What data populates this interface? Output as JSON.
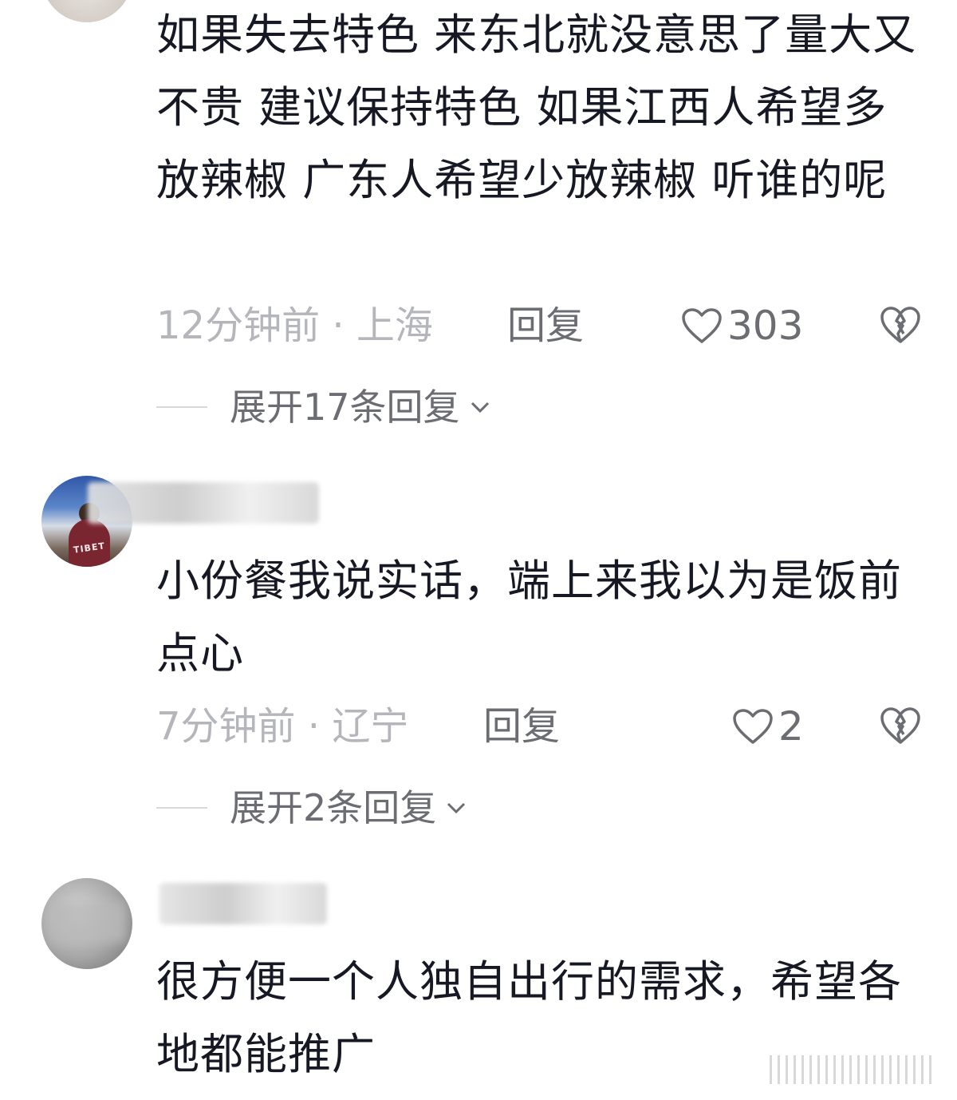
{
  "comments": [
    {
      "text": "如果失去特色 来东北就没意思了量大又不贵 建议保持特色 如果江西人希望多放辣椒 广东人希望少放辣椒 听谁的呢",
      "time_location": "12分钟前 · 上海",
      "reply_label": "回复",
      "like_count": "303",
      "expand_label": "展开17条回复"
    },
    {
      "text": "小份餐我说实话，端上来我以为是饭前点心",
      "time_location": "7分钟前 · 辽宁",
      "reply_label": "回复",
      "like_count": "2",
      "expand_label": "展开2条回复"
    },
    {
      "text": "很方便一个人独自出行的需求，希望各地都能推广"
    }
  ],
  "avatar_tags": {
    "tibet": "TIBET"
  },
  "icons": {
    "like": "heart-outline-icon",
    "dislike": "broken-heart-icon",
    "expand": "chevron-down-icon"
  },
  "colors": {
    "text": "#161823",
    "meta": "#b5b6bb",
    "action": "#6b6d73"
  }
}
